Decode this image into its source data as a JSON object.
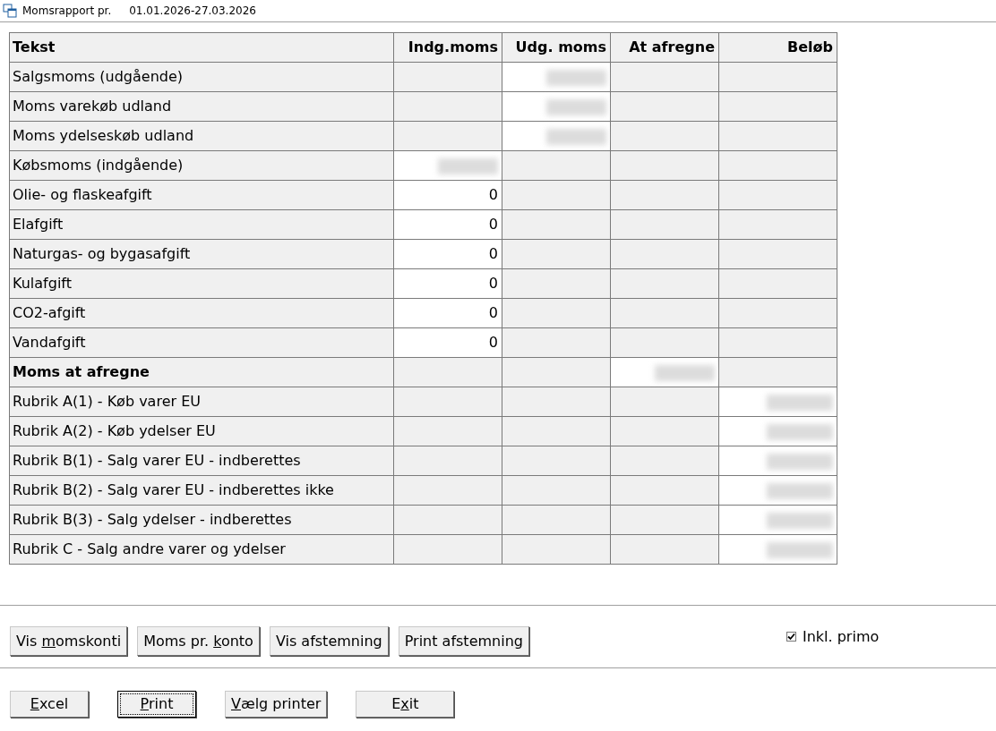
{
  "window": {
    "title": "Momsrapport pr.",
    "period": "01.01.2026-27.03.2026"
  },
  "table": {
    "columns": [
      "Tekst",
      "Indg.moms",
      "Udg. moms",
      "At afregne",
      "Beløb"
    ],
    "rows": [
      {
        "label": "Salgsmoms (udgående)",
        "bold": false,
        "cells": [
          null,
          {
            "redacted": true
          },
          null,
          null
        ]
      },
      {
        "label": "Moms varekøb udland",
        "bold": false,
        "cells": [
          null,
          {
            "redacted": true
          },
          null,
          null
        ]
      },
      {
        "label": "Moms ydelseskøb udland",
        "bold": false,
        "cells": [
          null,
          {
            "redacted": true
          },
          null,
          null
        ]
      },
      {
        "label": "Købsmoms (indgående)",
        "bold": false,
        "cells": [
          {
            "redacted": true
          },
          null,
          null,
          null
        ]
      },
      {
        "label": "Olie- og flaskeafgift",
        "bold": false,
        "cells": [
          {
            "value": "0"
          },
          null,
          null,
          null
        ]
      },
      {
        "label": "Elafgift",
        "bold": false,
        "cells": [
          {
            "value": "0"
          },
          null,
          null,
          null
        ]
      },
      {
        "label": "Naturgas- og bygasafgift",
        "bold": false,
        "cells": [
          {
            "value": "0"
          },
          null,
          null,
          null
        ]
      },
      {
        "label": "Kulafgift",
        "bold": false,
        "cells": [
          {
            "value": "0"
          },
          null,
          null,
          null
        ]
      },
      {
        "label": "CO2-afgift",
        "bold": false,
        "cells": [
          {
            "value": "0"
          },
          null,
          null,
          null
        ]
      },
      {
        "label": "Vandafgift",
        "bold": false,
        "cells": [
          {
            "value": "0"
          },
          null,
          null,
          null
        ]
      },
      {
        "label": "Moms at afregne",
        "bold": true,
        "cells": [
          null,
          null,
          {
            "redacted": true
          },
          null
        ]
      },
      {
        "label": "Rubrik A(1) - Køb varer EU",
        "bold": false,
        "cells": [
          null,
          null,
          null,
          {
            "redacted": true
          }
        ]
      },
      {
        "label": "Rubrik A(2) - Køb ydelser EU",
        "bold": false,
        "cells": [
          null,
          null,
          null,
          {
            "redacted": true
          }
        ]
      },
      {
        "label": "Rubrik B(1) - Salg varer EU - indberettes",
        "bold": false,
        "cells": [
          null,
          null,
          null,
          {
            "redacted": true
          }
        ]
      },
      {
        "label": "Rubrik B(2) - Salg varer EU - indberettes ikke",
        "bold": false,
        "cells": [
          null,
          null,
          null,
          {
            "redacted": true
          }
        ]
      },
      {
        "label": "Rubrik B(3) - Salg ydelser - indberettes",
        "bold": false,
        "cells": [
          null,
          null,
          null,
          {
            "redacted": true
          }
        ]
      },
      {
        "label": "Rubrik C - Salg andre varer og ydelser",
        "bold": false,
        "cells": [
          null,
          null,
          null,
          {
            "redacted": true
          }
        ]
      }
    ]
  },
  "action_buttons": [
    {
      "before": "Vis ",
      "key": "m",
      "after": "omskonti",
      "focused": false
    },
    {
      "before": "Moms pr. ",
      "key": "k",
      "after": "onto",
      "focused": false
    },
    {
      "before": "Vis afstemning",
      "focused": false
    },
    {
      "before": "Print afstemning",
      "focused": false
    }
  ],
  "include_primo": {
    "label": "Inkl. primo",
    "checked": true
  },
  "bottom_buttons": [
    {
      "key": "E",
      "after": "xcel",
      "focused": false
    },
    {
      "key": "P",
      "after": "rint",
      "focused": true
    },
    {
      "key": "V",
      "after": "ælg printer",
      "focused": false
    },
    {
      "before": "E",
      "key": "x",
      "after": "it",
      "focused": false
    }
  ]
}
